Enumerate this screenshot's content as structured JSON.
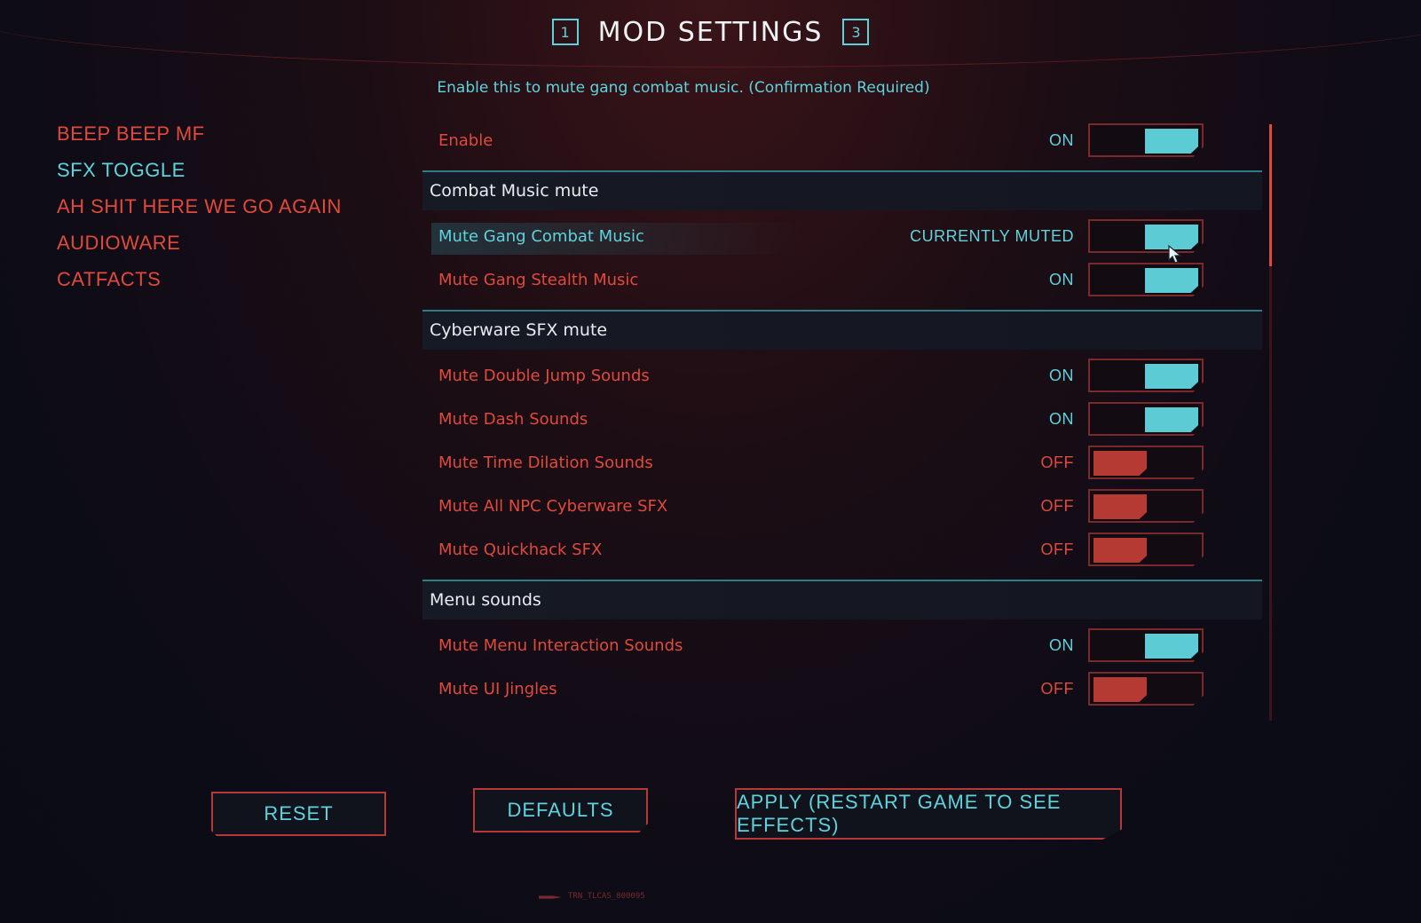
{
  "header": {
    "prev_key": "1",
    "title": "MOD SETTINGS",
    "next_key": "3"
  },
  "description": "Enable this to mute gang combat music. (Confirmation Required)",
  "sidebar": {
    "items": [
      {
        "label": "BEEP BEEP MF"
      },
      {
        "label": "SFX TOGGLE",
        "active": true
      },
      {
        "label": "AH SHIT HERE WE GO AGAIN"
      },
      {
        "label": "AUDIOWARE"
      },
      {
        "label": "CATFACTS"
      }
    ]
  },
  "settings": {
    "enable": {
      "label": "Enable",
      "state": "ON"
    },
    "combat_music": {
      "title": "Combat Music mute",
      "rows": [
        {
          "label": "Mute Gang Combat Music",
          "state": "CURRENTLY MUTED"
        },
        {
          "label": "Mute Gang Stealth Music",
          "state": "ON"
        }
      ]
    },
    "cyberware": {
      "title": "Cyberware SFX mute",
      "rows": [
        {
          "label": "Mute Double Jump Sounds",
          "state": "ON"
        },
        {
          "label": "Mute Dash Sounds",
          "state": "ON"
        },
        {
          "label": "Mute Time Dilation Sounds",
          "state": "OFF"
        },
        {
          "label": "Mute All NPC Cyberware SFX",
          "state": "OFF"
        },
        {
          "label": "Mute Quickhack SFX",
          "state": "OFF"
        }
      ]
    },
    "menu": {
      "title": "Menu sounds",
      "rows": [
        {
          "label": "Mute Menu Interaction Sounds",
          "state": "ON"
        },
        {
          "label": "Mute UI Jingles",
          "state": "OFF"
        }
      ]
    }
  },
  "buttons": {
    "reset": "RESET",
    "defaults": "DEFAULTS",
    "apply": "APPLY (RESTART GAME TO SEE EFFECTS)"
  },
  "footer_code": "TRN_TLCAS_800095",
  "colors": {
    "accent_cyan": "#5fd3dc",
    "accent_red": "#e04a3c",
    "toggle_on": "#5ccbd3",
    "toggle_off": "#b63a34"
  }
}
